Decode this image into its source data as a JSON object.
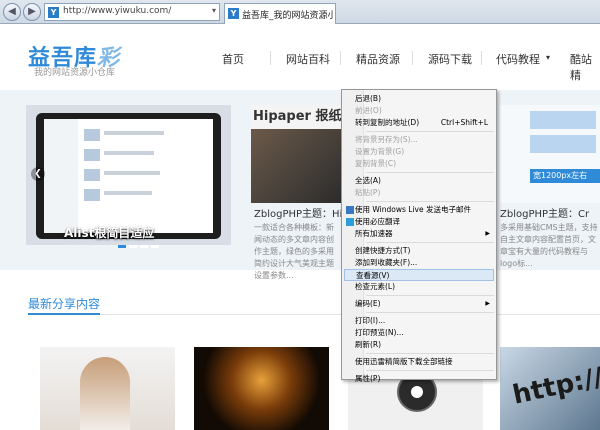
{
  "browser": {
    "back_icon": "back-arrow",
    "forward_icon": "forward-arrow",
    "url": "http://www.yiwuku.com/",
    "favicon_letter": "Y",
    "tab_title": "益吾库_我的网站资源小仓库"
  },
  "header": {
    "logo_main": "益吾库",
    "logo_accent": "彩",
    "logo_sub": "我的网站资源小仓库",
    "menu": [
      "首页",
      "网站百科",
      "精品资源",
      "源码下载",
      "代码教程",
      "酷站精"
    ]
  },
  "slider": {
    "slide1_caption": "Alist根简目适应",
    "slide2_banner": "Hipaper 报纸新闻",
    "slide2_title": "ZblogPHP主题：Hipap",
    "slide2_desc": "一款适合各种模板：新闻动态的多文章内容创作主题，绿色的多采用简约设计大气美观主题设置参数...",
    "slide3_tag": "宽1200px左右",
    "slide3_title": "ZblogPHP主题：Cr",
    "slide3_desc": "多采用基础CMS主题，支持自主文章内容配置首页，文章宝有大量的代码教程与logo标..."
  },
  "section": {
    "title": "最新分享内容",
    "card4_text": "http://w"
  },
  "context_menu": {
    "items": [
      {
        "label": "后退(B)",
        "state": "enabled"
      },
      {
        "label": "前进(O)",
        "state": "disabled"
      },
      {
        "label": "转到复制的地址(D)",
        "shortcut": "Ctrl+Shift+L",
        "state": "enabled"
      },
      {
        "separator": true
      },
      {
        "label": "将背景另存为(S)...",
        "state": "disabled"
      },
      {
        "label": "设置为背景(G)",
        "state": "disabled"
      },
      {
        "label": "复制背景(C)",
        "state": "disabled"
      },
      {
        "separator": true
      },
      {
        "label": "全选(A)",
        "state": "enabled"
      },
      {
        "label": "粘贴(P)",
        "state": "disabled"
      },
      {
        "separator": true
      },
      {
        "label": "使用 Windows Live 发送电子邮件",
        "icon": "windows-live-icon",
        "state": "enabled"
      },
      {
        "label": "使用必应翻译",
        "icon": "bing-translate-icon",
        "state": "enabled"
      },
      {
        "label": "所有加速器",
        "submenu": true,
        "state": "enabled"
      },
      {
        "separator": true
      },
      {
        "label": "创建快捷方式(T)",
        "state": "enabled"
      },
      {
        "label": "添加到收藏夹(F)...",
        "state": "enabled"
      },
      {
        "label": "查看源(V)",
        "state": "highlighted"
      },
      {
        "label": "检查元素(L)",
        "state": "enabled"
      },
      {
        "separator": true
      },
      {
        "label": "编码(E)",
        "submenu": true,
        "state": "enabled"
      },
      {
        "separator": true
      },
      {
        "label": "打印(I)...",
        "state": "enabled"
      },
      {
        "label": "打印预览(N)...",
        "state": "enabled"
      },
      {
        "label": "刷新(R)",
        "state": "enabled"
      },
      {
        "separator": true
      },
      {
        "label": "使用迅雷精简版下载全部链接",
        "state": "enabled"
      },
      {
        "separator": true
      },
      {
        "label": "属性(P)",
        "state": "enabled"
      }
    ]
  },
  "colors": {
    "brand_blue": "#2f8ad8",
    "menu_highlight": "#dbe9f7"
  }
}
